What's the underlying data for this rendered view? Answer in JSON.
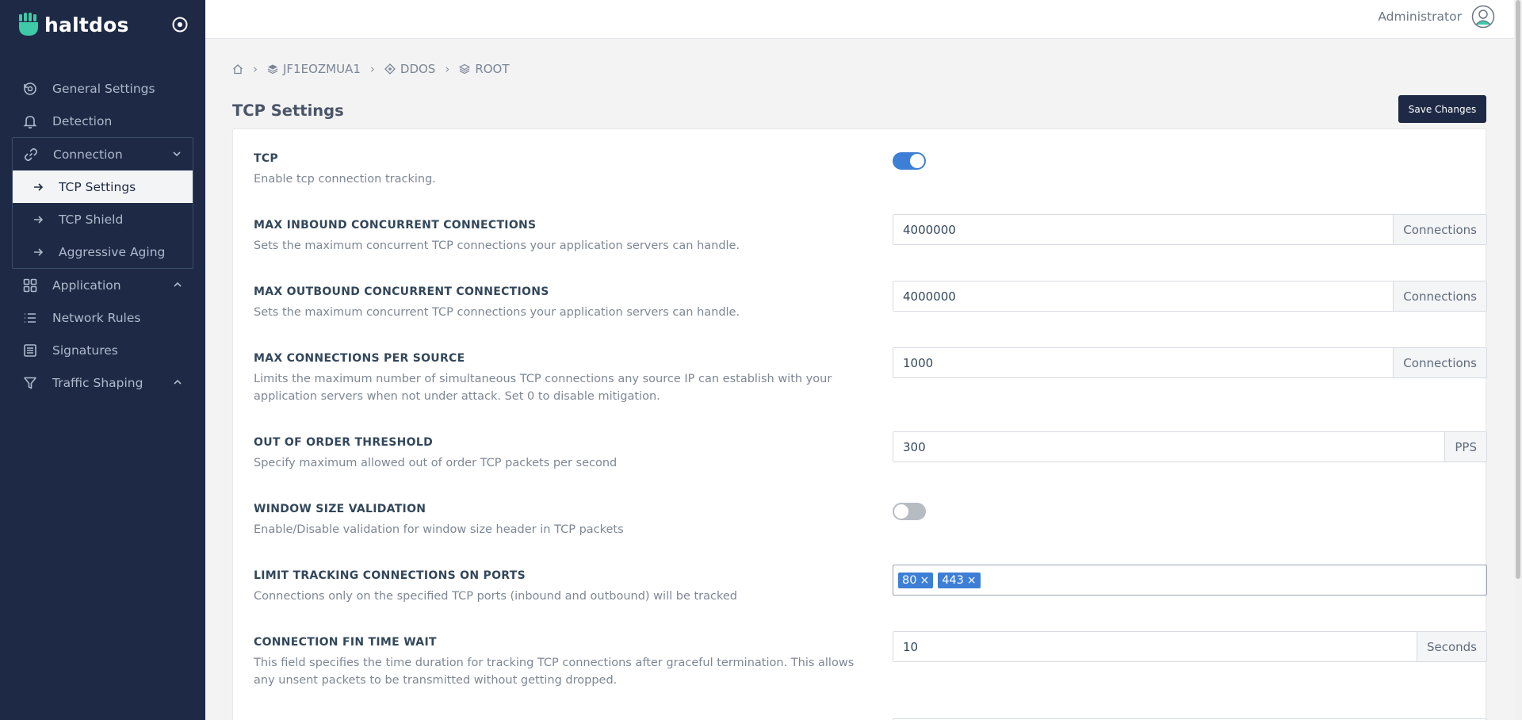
{
  "sidebar": {
    "brand": "haltdos",
    "items": [
      {
        "label": "General Settings",
        "icon": "settings-cycle-icon"
      },
      {
        "label": "Detection",
        "icon": "bell-icon"
      },
      {
        "label": "Connection",
        "icon": "link-icon",
        "expanded": true,
        "children": [
          {
            "label": "TCP Settings",
            "active": true
          },
          {
            "label": "TCP Shield"
          },
          {
            "label": "Aggressive Aging"
          }
        ]
      },
      {
        "label": "Application",
        "icon": "grid-icon"
      },
      {
        "label": "Network Rules",
        "icon": "list-icon"
      },
      {
        "label": "Signatures",
        "icon": "document-list-icon"
      },
      {
        "label": "Traffic Shaping",
        "icon": "filter-icon"
      }
    ]
  },
  "header": {
    "user": "Administrator"
  },
  "breadcrumb": [
    "JF1EOZMUA1",
    "DDOS",
    "ROOT"
  ],
  "page": {
    "title": "TCP Settings",
    "save_label": "Save Changes"
  },
  "settings": [
    {
      "label": "TCP",
      "desc": "Enable tcp connection tracking.",
      "type": "toggle",
      "value": true
    },
    {
      "label": "MAX INBOUND CONCURRENT CONNECTIONS",
      "desc": "Sets the maximum concurrent TCP connections your application servers can handle.",
      "type": "input",
      "value": "4000000",
      "unit": "Connections"
    },
    {
      "label": "MAX OUTBOUND CONCURRENT CONNECTIONS",
      "desc": "Sets the maximum concurrent TCP connections your application servers can handle.",
      "type": "input",
      "value": "4000000",
      "unit": "Connections"
    },
    {
      "label": "MAX CONNECTIONS PER SOURCE",
      "desc": "Limits the maximum number of simultaneous TCP connections any source IP can establish with your application servers when not under attack. Set 0 to disable mitigation.",
      "type": "input",
      "value": "1000",
      "unit": "Connections"
    },
    {
      "label": "OUT OF ORDER THRESHOLD",
      "desc": "Specify maximum allowed out of order TCP packets per second",
      "type": "input",
      "value": "300",
      "unit": "PPS"
    },
    {
      "label": "WINDOW SIZE VALIDATION",
      "desc": "Enable/Disable validation for window size header in TCP packets",
      "type": "toggle",
      "value": false
    },
    {
      "label": "LIMIT TRACKING CONNECTIONS ON PORTS",
      "desc": "Connections only on the specified TCP ports (inbound and outbound) will be tracked",
      "type": "tags",
      "tags": [
        "80",
        "443"
      ]
    },
    {
      "label": "CONNECTION FIN TIME WAIT",
      "desc": "This field specifies the time duration for tracking TCP connections after graceful termination. This allows any unsent packets to be transmitted without getting dropped.",
      "type": "input",
      "value": "10",
      "unit": "Seconds"
    }
  ]
}
